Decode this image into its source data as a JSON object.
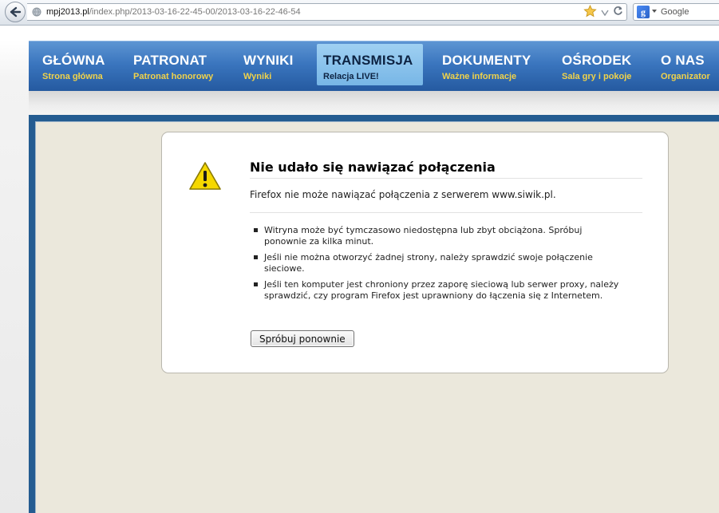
{
  "browser": {
    "url_host": "mpj2013.pl",
    "url_path": "/index.php/2013-03-16-22-45-00/2013-03-16-22-46-54",
    "search_placeholder": "Google",
    "search_engine_letter": "g"
  },
  "nav": {
    "items": [
      {
        "label": "GŁÓWNA",
        "sub": "Strona główna"
      },
      {
        "label": "PATRONAT",
        "sub": "Patronat honorowy"
      },
      {
        "label": "WYNIKI",
        "sub": "Wyniki"
      },
      {
        "label": "TRANSMISJA",
        "sub": "Relacja LIVE!"
      },
      {
        "label": "DOKUMENTY",
        "sub": "Ważne informacje"
      },
      {
        "label": "OŚRODEK",
        "sub": "Sala gry i pokoje"
      },
      {
        "label": "O NAS",
        "sub": "Organizator"
      }
    ],
    "active_index": 3
  },
  "error": {
    "title": "Nie udało się nawiązać połączenia",
    "description": "Firefox nie może nawiązać połączenia z serwerem www.siwik.pl.",
    "items": [
      "Witryna może być tymczasowo niedostępna lub zbyt obciążona. Spróbuj ponownie za kilka minut.",
      "Jeśli nie można otworzyć żadnej strony, należy sprawdzić swoje połączenie sieciowe.",
      "Jeśli ten komputer jest chroniony przez zaporę sieciową lub serwer proxy, należy sprawdzić, czy program Firefox jest uprawniony do łączenia się z Internetem."
    ],
    "retry_label": "Spróbuj ponownie"
  },
  "colors": {
    "nav_top": "#5d95d3",
    "nav_bottom": "#24599f",
    "nav_sub": "#f0d24a",
    "nav_active": "#8cc6ee",
    "content_frame": "#245c91",
    "content_bg": "#ebe8dc",
    "warning_yellow": "#f5d800"
  }
}
